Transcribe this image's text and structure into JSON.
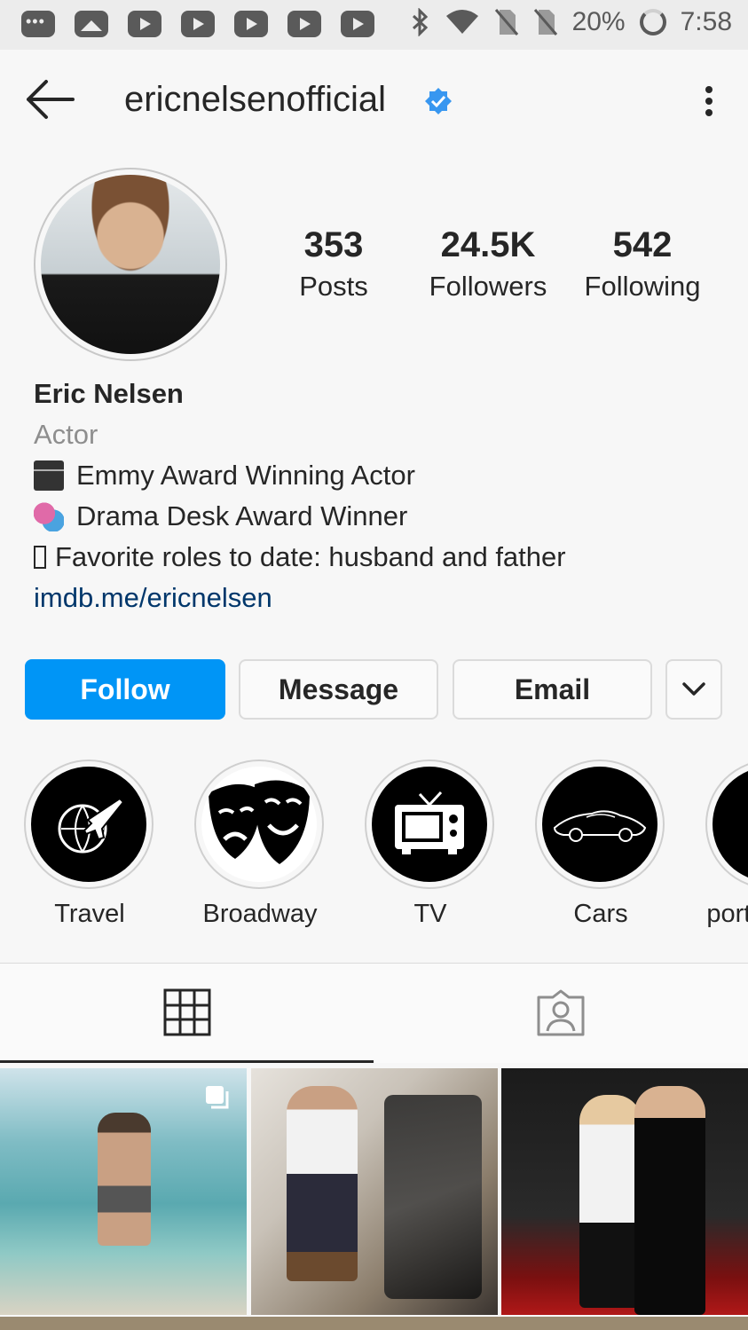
{
  "status_bar": {
    "battery": "20%",
    "time": "7:58"
  },
  "header": {
    "username": "ericnelsenofficial"
  },
  "profile": {
    "stats": [
      {
        "value": "353",
        "label": "Posts"
      },
      {
        "value": "24.5K",
        "label": "Followers"
      },
      {
        "value": "542",
        "label": "Following"
      }
    ],
    "name": "Eric Nelsen",
    "category": "Actor",
    "bio_lines": [
      "Emmy Award Winning Actor",
      "Drama Desk Award Winner",
      "Favorite roles to date: husband and father"
    ],
    "link": "imdb.me/ericnelsen"
  },
  "buttons": {
    "follow": "Follow",
    "message": "Message",
    "email": "Email"
  },
  "highlights": [
    {
      "label": "Travel",
      "icon": "globe-plane-icon"
    },
    {
      "label": "Broadway",
      "icon": "theater-masks-icon"
    },
    {
      "label": "TV",
      "icon": "tv-icon"
    },
    {
      "label": "Cars",
      "icon": "car-icon"
    },
    {
      "label": "Sport",
      "icon": "sport-icon"
    }
  ],
  "tabs": {
    "grid": "grid-icon",
    "tagged": "tagged-user-icon"
  },
  "colors": {
    "follow_blue": "#0095f6",
    "link_blue": "#00376b",
    "verified_blue": "#3897f0"
  }
}
